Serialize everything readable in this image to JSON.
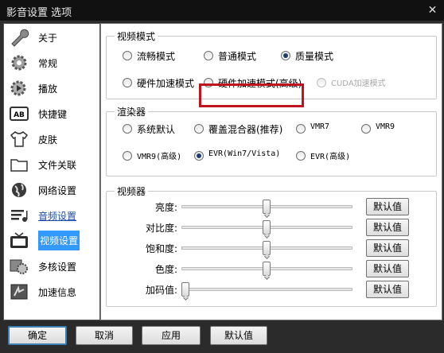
{
  "window": {
    "title": "影音设置 选项",
    "close_label": "✕"
  },
  "sidebar": {
    "items": [
      {
        "label": "关于",
        "icon": "wrench-icon"
      },
      {
        "label": "常规",
        "icon": "gear-icon"
      },
      {
        "label": "播放",
        "icon": "play-gear-icon"
      },
      {
        "label": "快捷键",
        "icon": "keyboard-ab-icon"
      },
      {
        "label": "皮肤",
        "icon": "tshirt-icon"
      },
      {
        "label": "文件关联",
        "icon": "folder-icon"
      },
      {
        "label": "网络设置",
        "icon": "globe-icon"
      },
      {
        "label": "音频设置",
        "icon": "audio-lines-icon"
      },
      {
        "label": "视频设置",
        "icon": "tv-icon"
      },
      {
        "label": "多核设置",
        "icon": "multicore-gear-icon"
      },
      {
        "label": "加速信息",
        "icon": "accelerate-icon"
      }
    ],
    "selected": "视频设置",
    "hovered": "音频设置"
  },
  "video_mode": {
    "title": "视频模式",
    "options": [
      {
        "label": "流畅模式",
        "checked": false,
        "disabled": false
      },
      {
        "label": "普通模式",
        "checked": false,
        "disabled": false
      },
      {
        "label": "质量模式",
        "checked": true,
        "disabled": false
      },
      {
        "label": "硬件加速模式",
        "checked": false,
        "disabled": false
      },
      {
        "label": "硬件加速模式(高级)",
        "checked": false,
        "disabled": false
      },
      {
        "label": "CUDA加速模式",
        "checked": false,
        "disabled": true
      }
    ]
  },
  "renderer": {
    "title": "渲染器",
    "options": [
      {
        "label": "系统默认",
        "checked": false
      },
      {
        "label": "覆盖混合器(推荐)",
        "checked": false
      },
      {
        "label": "VMR7",
        "checked": false
      },
      {
        "label": "VMR9",
        "checked": false
      },
      {
        "label": "VMR9(高级)",
        "checked": false
      },
      {
        "label": "EVR(Win7/Vista)",
        "checked": true
      },
      {
        "label": "EVR(高级)",
        "checked": false
      }
    ]
  },
  "video_adjust": {
    "title": "视频器",
    "default_label": "默认值",
    "sliders": [
      {
        "label": "亮度:",
        "value_fraction": 0.5
      },
      {
        "label": "对比度:",
        "value_fraction": 0.5
      },
      {
        "label": "饱和度:",
        "value_fraction": 0.5
      },
      {
        "label": "色度:",
        "value_fraction": 0.5
      },
      {
        "label": "加码值:",
        "value_fraction": 0.0
      }
    ]
  },
  "footer": {
    "ok_label": "确定",
    "cancel_label": "取消",
    "apply_label": "应用",
    "default_label": "默认值"
  },
  "colors": {
    "selection": "#3399ff",
    "highlight_box": "#c1121f",
    "link_hover": "#1a4ba8"
  }
}
